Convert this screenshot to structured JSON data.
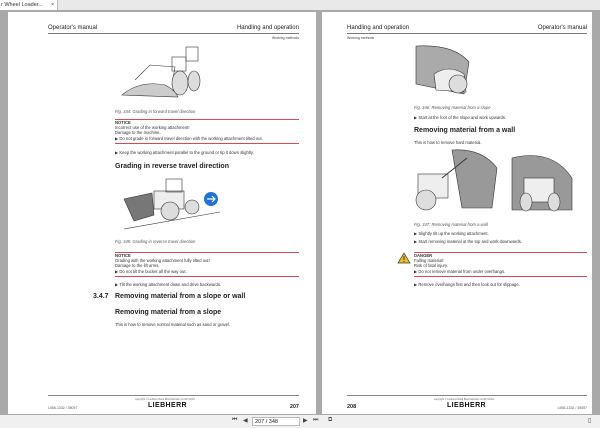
{
  "tab": {
    "title": "r Wheel Loader...",
    "close": "×"
  },
  "left_page": {
    "header_left": "Operator's manual",
    "header_right": "Handling and operation",
    "subheader": "Working methods",
    "fig344": "Fig. 344: Grading in forward travel direction",
    "notice1": {
      "title": "NOTICE",
      "line1": "Incorrect use of the working attachment!",
      "line2": "Damage to the machine.",
      "action": "Do not grade in forward travel direction with the working attachment tilted out."
    },
    "step1": "Keep the working attachment parallel to the ground or tip it down slightly.",
    "heading_reverse": "Grading in reverse travel direction",
    "fig345": "Fig. 345: Grading in reverse travel direction",
    "notice2": {
      "title": "NOTICE",
      "line1": "Grading with the working attachment fully tilted out!",
      "line2": "Damage to the lift arms.",
      "action": "Do not tilt the bucket all the way out."
    },
    "step2": "Tilt the working attachment down and drive backwards.",
    "section_number": "3.4.7",
    "section_title": "Removing material from a slope or wall",
    "heading_slope": "Removing material from a slope",
    "slope_text": "This is how to remove normal material such as sand or gravel.",
    "footer_code": "L556-1332 / 35057",
    "copyright": "copyright © Liebherr-Werk Bischofshofen GmbH 2019",
    "logo": "LIEBHERR",
    "page_number": "207"
  },
  "right_page": {
    "header_left": "Handling and operation",
    "header_right": "Operator's manual",
    "subheader": "Working methods",
    "fig346": "Fig. 346: Removing material from a slope",
    "step1": "Start at the foot of the slope and work upwards.",
    "heading_wall": "Removing material from a wall",
    "wall_text": "This is how to remove hard material.",
    "fig347": "Fig. 347: Removing material from a wall",
    "step2": "Slightly tilt up the working attachment.",
    "step3": "Start removing material at the top and work downwards.",
    "danger": {
      "title": "DANGER",
      "line1": "Falling material!",
      "line2": "Risk of fatal injury.",
      "action": "Do not remove material from under overhangs."
    },
    "step4": "Remove overhangs first and then look out for slippage.",
    "page_number": "208",
    "copyright": "copyright © Liebherr-Werk Bischofshofen GmbH 2019",
    "logo": "LIEBHERR",
    "footer_code": "L556-1332 / 35057"
  },
  "toolbar": {
    "current_page": "207 / 348"
  },
  "colors": {
    "rule": "#d24b55",
    "arrow": "#1e73d8",
    "warning": "#f0c020"
  }
}
